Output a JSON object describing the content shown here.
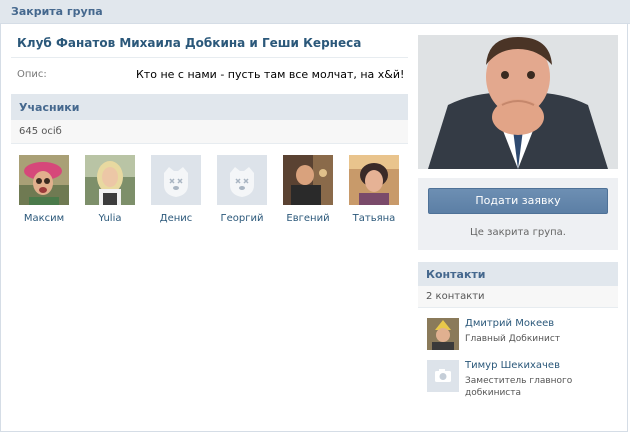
{
  "header": {
    "title": "Закрита група"
  },
  "group": {
    "name": "Клуб Фанатов Михаила Добкина и Геши Кернеса",
    "description_label": "Опис:",
    "description": "Кто не с нами - пусть там все молчат, на х&й!"
  },
  "members": {
    "title": "Учасники",
    "count": "645 осіб",
    "items": [
      {
        "name": "Максим",
        "icon": "user-photo"
      },
      {
        "name": "Yulia",
        "icon": "user-photo"
      },
      {
        "name": "Денис",
        "icon": "dog-placeholder-icon"
      },
      {
        "name": "Георгий",
        "icon": "dog-placeholder-icon"
      },
      {
        "name": "Евгений",
        "icon": "user-photo"
      },
      {
        "name": "Татьяна",
        "icon": "user-photo"
      }
    ]
  },
  "join": {
    "button_label": "Подати заявку",
    "note": "Це закрита група."
  },
  "contacts": {
    "title": "Контакти",
    "count": "2 контакти",
    "items": [
      {
        "name": "Дмитрий Мокеев",
        "role": "Главный Добкинист"
      },
      {
        "name": "Тимур Шекихачев",
        "role": "Заместитель главного добкиниста"
      }
    ]
  },
  "colors": {
    "link": "#2b587a",
    "header_bg": "#e1e7ed",
    "header_text": "#45688e",
    "button": "#5c7fa5"
  }
}
